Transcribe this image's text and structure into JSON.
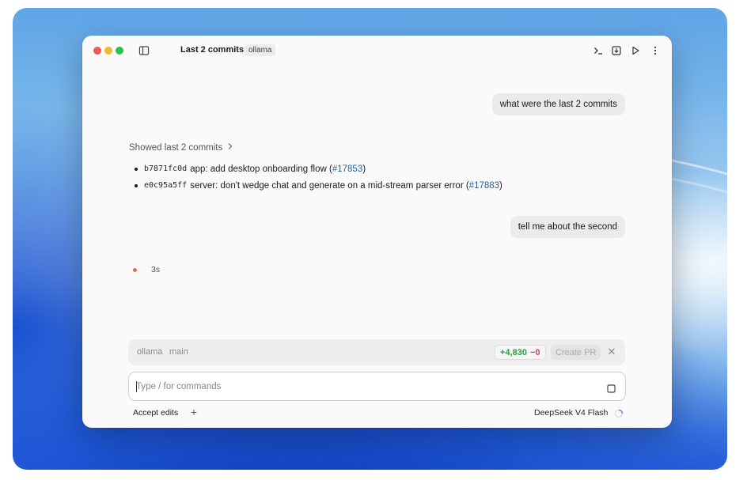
{
  "window": {
    "title": "Last 2 commits",
    "project_badge": "ollama"
  },
  "toolbar": {
    "icons": [
      "terminal-icon",
      "download-icon",
      "play-icon",
      "more-vertical-icon"
    ]
  },
  "chat": {
    "messages": [
      {
        "role": "user",
        "text": "what were the last 2 commits"
      },
      {
        "role": "user",
        "text": "tell me about the second"
      }
    ],
    "summary_label": "Showed last 2 commits",
    "commits": [
      {
        "hash": "b7871fc0d",
        "message": "app: add desktop onboarding flow (",
        "pr": "#17853",
        "close": ")"
      },
      {
        "hash": "e0c95a5ff",
        "message": "server: don't wedge chat and generate on a mid-stream parser error (",
        "pr": "#17883",
        "close": ")"
      }
    ],
    "status_time": "3s"
  },
  "repo_bar": {
    "repo": "ollama",
    "branch": "main",
    "additions": "+4,830",
    "deletions": "−0",
    "create_pr_label": "Create PR"
  },
  "composer": {
    "placeholder": "Type / for commands",
    "value": ""
  },
  "footer": {
    "accept_edits_label": "Accept edits",
    "model": "DeepSeek V4 Flash"
  },
  "colors": {
    "link": "#2a5f9e",
    "additions": "#2e9a44",
    "deletions": "#c64b4b",
    "status_dot": "#d96a5c"
  }
}
